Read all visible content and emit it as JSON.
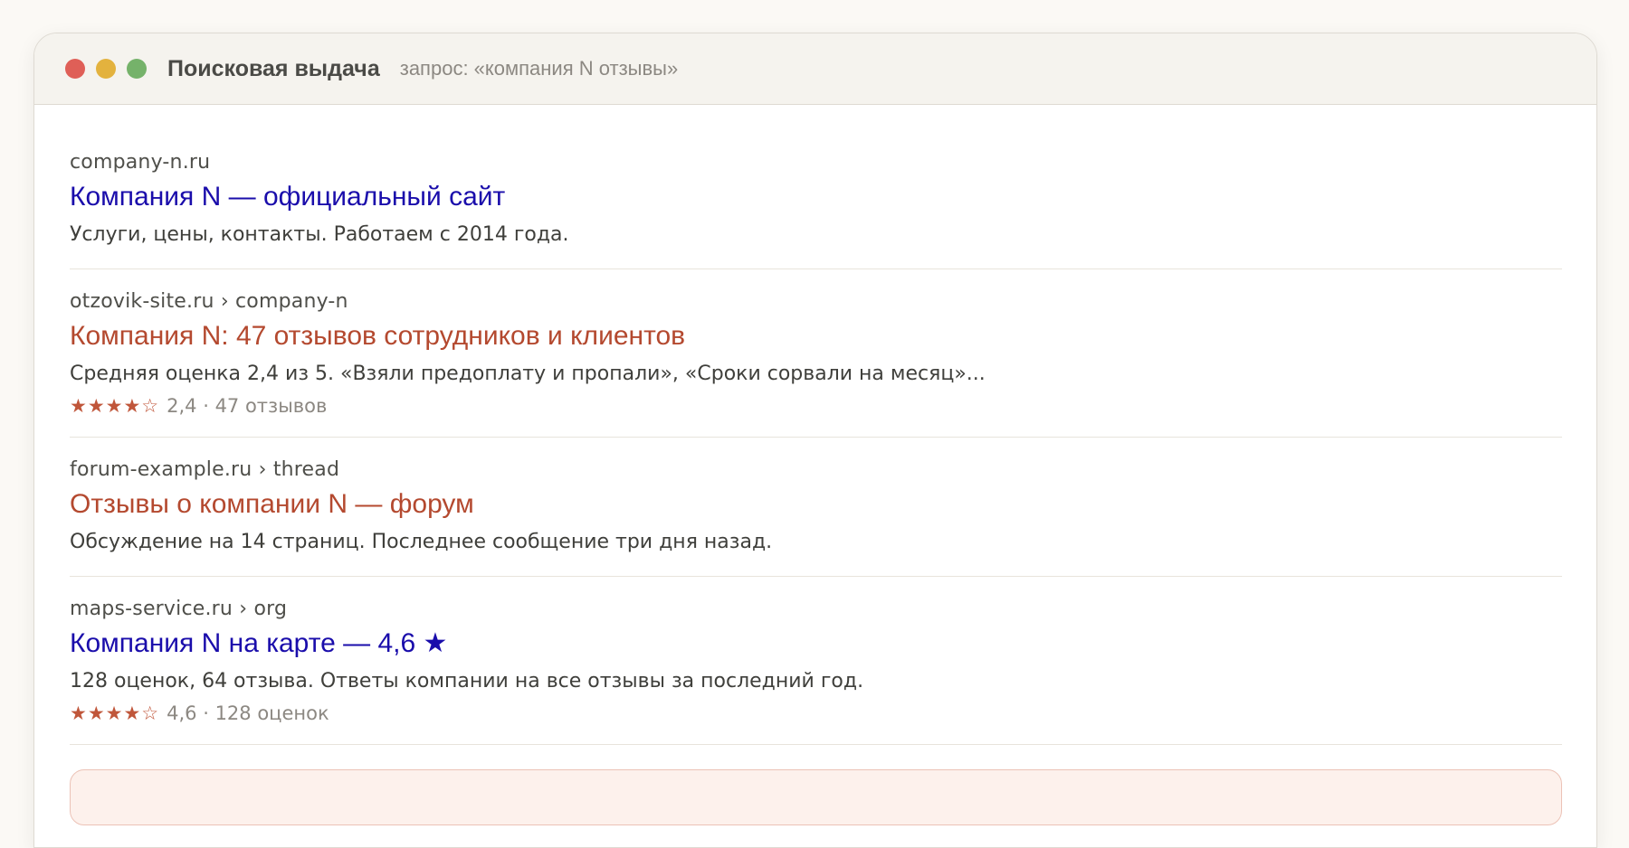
{
  "window": {
    "title": "Поисковая выдача",
    "query": "запрос: «компания N отзывы»"
  },
  "results": [
    {
      "url": "company-n.ru",
      "title": "Компания N — официальный сайт",
      "snippet": "Услуги, цены, контакты. Работаем с 2014 года.",
      "title_color": "#1a0dab"
    },
    {
      "url": "otzovik-site.ru › company-n",
      "title": "Компания N: 47 отзывов сотрудников и клиентов",
      "snippet": "Средняя оценка 2,4 из 5. «Взяли предоплату и пропали», «Сроки сорвали на месяц»...",
      "rating_stars": "★★★★☆",
      "rating_text": "2,4 · 47 отзывов",
      "title_color": "#b4492f"
    },
    {
      "url": "forum-example.ru › thread",
      "title": "Отзывы о компании N — форум",
      "snippet": "Обсуждение на 14 страниц. Последнее сообщение три дня назад.",
      "title_color": "#b4492f"
    },
    {
      "url": "maps-service.ru › org",
      "title": "Компания N на карте — 4,6 ★",
      "snippet": "128 оценок, 64 отзыва. Ответы компании на все отзывы за последний год.",
      "rating_stars": "★★★★☆",
      "rating_text": "4,6 · 128 оценок",
      "title_color": "#1a0dab"
    }
  ],
  "colors": {
    "link_blue": "#1a0dab",
    "link_rust": "#b4492f",
    "star": "#c0563a"
  }
}
